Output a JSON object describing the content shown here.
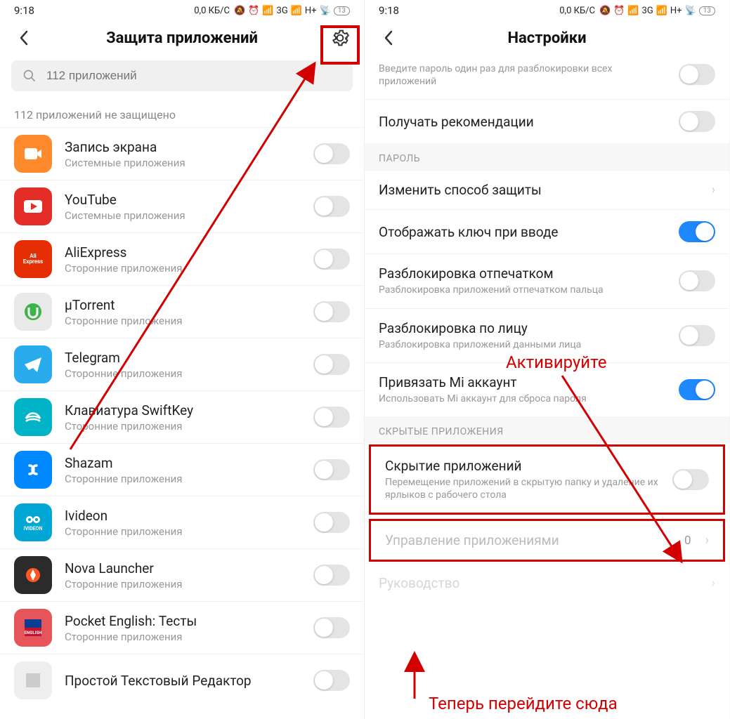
{
  "status": {
    "time": "9:18",
    "speed": "0,0 КБ/С",
    "net1": "3G",
    "net2": "H+",
    "battery": "13"
  },
  "left": {
    "title": "Защита приложений",
    "search_placeholder": "112 приложений",
    "unprotected_label": "112 приложений не защищено",
    "apps": [
      {
        "name": "Запись экрана",
        "sub": "Системные приложения",
        "icon_bg": "#ff8a2b",
        "icon_tag": "camera"
      },
      {
        "name": "YouTube",
        "sub": "Системные приложения",
        "icon_bg": "#e52d27",
        "icon_tag": "youtube"
      },
      {
        "name": "AliExpress",
        "sub": "Сторонние приложения",
        "icon_bg": "#e62e04",
        "icon_tag": "aliexpress"
      },
      {
        "name": "μTorrent",
        "sub": "Сторонние приложения",
        "icon_bg": "#e9e9e9",
        "icon_tag": "utorrent"
      },
      {
        "name": "Telegram",
        "sub": "Сторонние приложения",
        "icon_bg": "#2aabee",
        "icon_tag": "telegram"
      },
      {
        "name": "Клавиатура SwiftKey",
        "sub": "Сторонние приложения",
        "icon_bg": "#00b3c7",
        "icon_tag": "swiftkey"
      },
      {
        "name": "Shazam",
        "sub": "Сторонние приложения",
        "icon_bg": "#0088ff",
        "icon_tag": "shazam"
      },
      {
        "name": "Ivideon",
        "sub": "Сторонние приложения",
        "icon_bg": "#00a6d6",
        "icon_tag": "ivideon"
      },
      {
        "name": "Nova Launcher",
        "sub": "Сторонние приложения",
        "icon_bg": "#2b2b2b",
        "icon_tag": "nova"
      },
      {
        "name": "Pocket English: Тесты",
        "sub": "Сторонние приложения",
        "icon_bg": "#e5555a",
        "icon_tag": "pocket"
      },
      {
        "name": "Простой Текстовый Редактор",
        "sub": "",
        "icon_bg": "#eee",
        "icon_tag": "text"
      }
    ]
  },
  "right": {
    "title": "Настройки",
    "truncated_sub": "Введите пароль один раз для разблокировки всех приложений",
    "recommendations": "Получать рекомендации",
    "section_password": "ПАРОЛЬ",
    "change_method": "Изменить способ защиты",
    "show_key": "Отображать ключ при вводе",
    "fingerprint_title": "Разблокировка отпечатком",
    "fingerprint_sub": "Разблокировка приложений отпечатком пальца",
    "face_title": "Разблокировка по лицу",
    "face_sub": "Разблокировка приложений данными лица",
    "mi_title": "Привязать Mi аккаунт",
    "mi_sub": "Использовать Mi аккаунт для сброса пароля",
    "section_hidden": "СКРЫТЫЕ ПРИЛОЖЕНИЯ",
    "hide_title": "Скрытие приложений",
    "hide_sub": "Перемещение приложений в скрытую папку и удаление их ярлыков с рабочего стола",
    "manage_title": "Управление приложениями",
    "manage_value": "0",
    "guide": "Руководство"
  },
  "annotations": {
    "activate": "Активируйте",
    "goto": "Теперь перейдите сюда"
  }
}
